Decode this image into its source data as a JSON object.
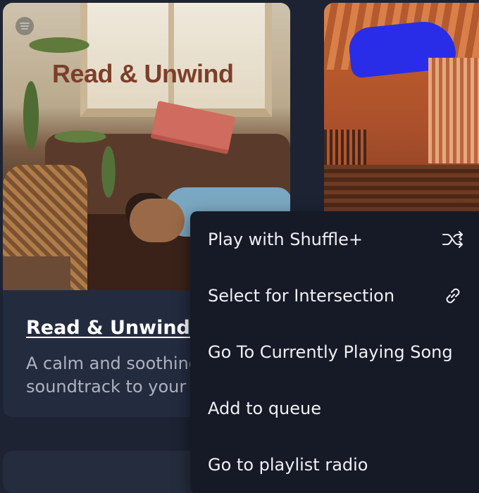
{
  "cards": [
    {
      "art_title": "Read & Unwind",
      "title": "Read & Unwind",
      "description": "A calm and soothing soundtrack to your"
    }
  ],
  "menu": {
    "items": [
      {
        "label": "Play with Shuffle+",
        "icon": "shuffle-icon"
      },
      {
        "label": "Select for Intersection",
        "icon": "link-icon"
      },
      {
        "label": "Go To Currently Playing Song",
        "icon": ""
      },
      {
        "label": "Add to queue",
        "icon": ""
      },
      {
        "label": "Go to playlist radio",
        "icon": ""
      }
    ]
  },
  "colors": {
    "background": "#1d2333",
    "card": "#232b3f",
    "menu": "#161a26",
    "menu_text": "#eef0f5",
    "description_text": "#aeb3bf"
  }
}
